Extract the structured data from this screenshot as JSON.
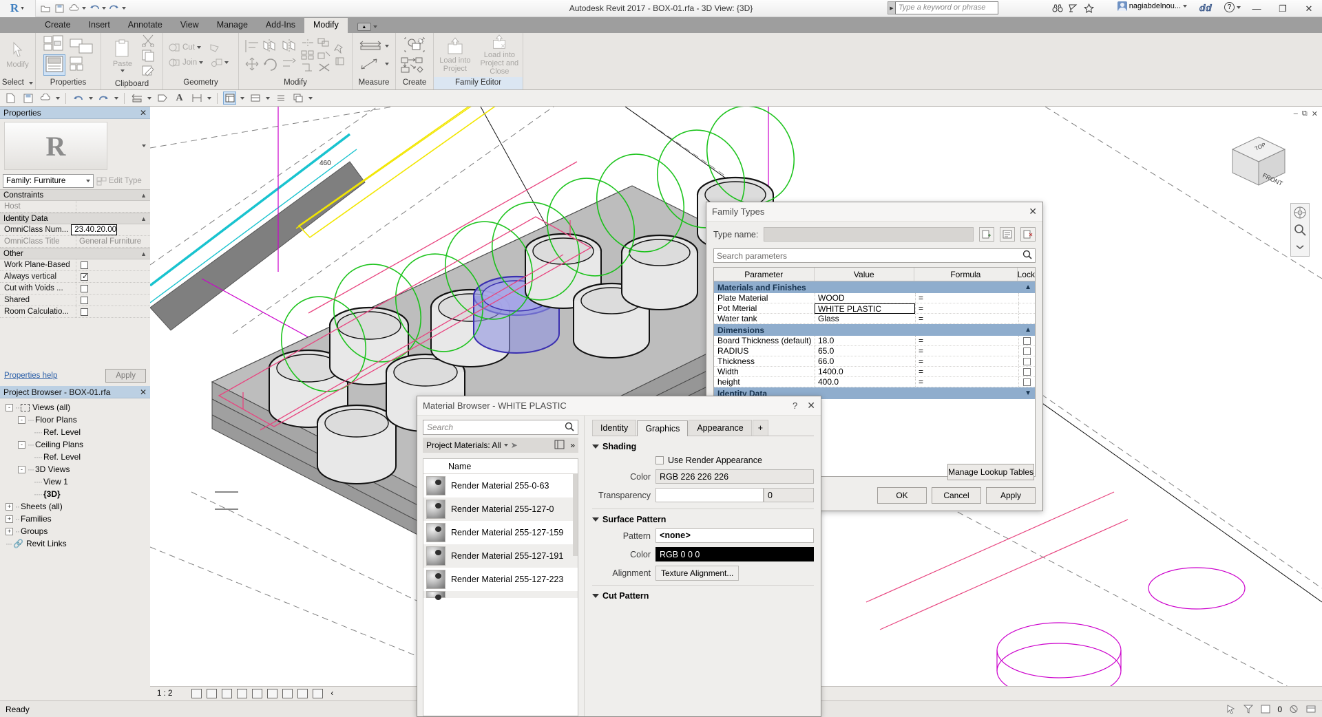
{
  "titlebar": {
    "app_title": "Autodesk Revit 2017 -   BOX-01.rfa - 3D View: {3D}",
    "search_placeholder": "Type a keyword or phrase",
    "account_name": "nagiabdelnou...",
    "help_label": "?",
    "minimize": "—",
    "maximize": "❐",
    "close": "✕",
    "logo": "R"
  },
  "ribbon": {
    "tabs": [
      {
        "label": "Create",
        "active": false
      },
      {
        "label": "Insert",
        "active": false
      },
      {
        "label": "Annotate",
        "active": false
      },
      {
        "label": "View",
        "active": false
      },
      {
        "label": "Manage",
        "active": false
      },
      {
        "label": "Add-Ins",
        "active": false
      },
      {
        "label": "Modify",
        "active": true
      }
    ],
    "panels": [
      {
        "title": "Select",
        "main_label": "Modify"
      },
      {
        "title": "Properties"
      },
      {
        "title": "Clipboard",
        "main_label": "Paste"
      },
      {
        "title": "Geometry",
        "items": [
          "Cut",
          "Join"
        ]
      },
      {
        "title": "Modify"
      },
      {
        "title": "Measure"
      },
      {
        "title": "Create"
      },
      {
        "title": "Family Editor",
        "items": [
          "Load into Project",
          "Load into Project and Close"
        ]
      }
    ],
    "geometry_cut": "Cut",
    "geometry_join": "Join",
    "load_into_project": "Load into\nProject",
    "load_into_project_close": "Load into\nProject and Close"
  },
  "properties": {
    "header": "Properties",
    "close": "✕",
    "family_type": "Family: Furniture",
    "edit_type": "Edit Type",
    "help_link": "Properties help",
    "apply_button": "Apply",
    "groups": [
      {
        "name": "Constraints",
        "rows": [
          {
            "key": "Host",
            "value": "",
            "dim": true,
            "type": "text"
          }
        ]
      },
      {
        "name": "Identity Data",
        "rows": [
          {
            "key": "OmniClass Num...",
            "value": "23.40.20.00",
            "type": "text-active"
          },
          {
            "key": "OmniClass Title",
            "value": "General Furniture",
            "dim": true,
            "type": "text"
          }
        ]
      },
      {
        "name": "Other",
        "rows": [
          {
            "key": "Work Plane-Based",
            "value": "",
            "type": "checkbox",
            "checked": false
          },
          {
            "key": "Always vertical",
            "value": "",
            "type": "checkbox",
            "checked": true
          },
          {
            "key": "Cut with Voids ...",
            "value": "",
            "type": "checkbox",
            "checked": false
          },
          {
            "key": "Shared",
            "value": "",
            "type": "checkbox",
            "checked": false
          },
          {
            "key": "Room Calculatio...",
            "value": "",
            "type": "checkbox",
            "checked": false
          }
        ]
      }
    ]
  },
  "project_browser": {
    "header": "Project Browser - BOX-01.rfa",
    "close": "✕",
    "nodes": [
      {
        "label": "Views (all)",
        "indent": 0,
        "expander": "-",
        "icon": true
      },
      {
        "label": "Floor Plans",
        "indent": 1,
        "expander": "-"
      },
      {
        "label": "Ref. Level",
        "indent": 2,
        "expander": ""
      },
      {
        "label": "Ceiling Plans",
        "indent": 1,
        "expander": "-"
      },
      {
        "label": "Ref. Level",
        "indent": 2,
        "expander": ""
      },
      {
        "label": "3D Views",
        "indent": 1,
        "expander": "-"
      },
      {
        "label": "View 1",
        "indent": 2,
        "expander": ""
      },
      {
        "label": "{3D}",
        "indent": 2,
        "expander": "",
        "bold": true
      },
      {
        "label": "Sheets (all)",
        "indent": 0,
        "expander": "+"
      },
      {
        "label": "Families",
        "indent": 0,
        "expander": "+"
      },
      {
        "label": "Groups",
        "indent": 0,
        "expander": "+"
      },
      {
        "label": "Revit Links",
        "indent": 0,
        "expander": ""
      }
    ]
  },
  "view": {
    "scale": "1 : 2",
    "cube_top": "TOP",
    "cube_front": "FRONT"
  },
  "statusbar": {
    "ready": "Ready",
    "selection_count": "0"
  },
  "family_types": {
    "title": "Family Types",
    "close": "✕",
    "type_name_label": "Type name:",
    "type_name_value": "",
    "search_placeholder": "Search parameters",
    "columns": [
      "Parameter",
      "Value",
      "Formula",
      "Lock"
    ],
    "groups": [
      {
        "name": "Materials and Finishes",
        "rows": [
          {
            "parameter": "Plate Material",
            "value": "WOOD",
            "formula": "=",
            "lock": false,
            "boxed": false
          },
          {
            "parameter": "Pot Mterial",
            "value": "WHITE PLASTIC",
            "formula": "=",
            "lock": false,
            "boxed": true
          },
          {
            "parameter": "Water tank",
            "value": "Glass",
            "formula": "=",
            "lock": false,
            "boxed": false
          }
        ]
      },
      {
        "name": "Dimensions",
        "rows": [
          {
            "parameter": "Board Thickness (default)",
            "value": "18.0",
            "formula": "=",
            "lock": true,
            "boxed": false
          },
          {
            "parameter": "RADIUS",
            "value": "65.0",
            "formula": "=",
            "lock": true,
            "boxed": false
          },
          {
            "parameter": "Thickness",
            "value": "66.0",
            "formula": "=",
            "lock": true,
            "boxed": false
          },
          {
            "parameter": "Width",
            "value": "1400.0",
            "formula": "=",
            "lock": true,
            "boxed": false
          },
          {
            "parameter": "height",
            "value": "400.0",
            "formula": "=",
            "lock": true,
            "boxed": false
          }
        ]
      },
      {
        "name": "Identity Data",
        "rows": []
      }
    ],
    "manage_lookup_tables": "Manage Lookup Tables",
    "ok": "OK",
    "cancel": "Cancel",
    "apply": "Apply"
  },
  "material_browser": {
    "title": "Material Browser - WHITE PLASTIC",
    "help": "?",
    "close": "✕",
    "search_placeholder": "Search",
    "filter_label": "Project Materials: All",
    "more": "»",
    "list_header": "Name",
    "materials": [
      {
        "name": "Render Material 255-0-63"
      },
      {
        "name": "Render Material 255-127-0"
      },
      {
        "name": "Render Material 255-127-159"
      },
      {
        "name": "Render Material 255-127-191"
      },
      {
        "name": "Render Material 255-127-223"
      }
    ],
    "tabs": [
      {
        "label": "Identity",
        "active": false
      },
      {
        "label": "Graphics",
        "active": true
      },
      {
        "label": "Appearance",
        "active": false
      }
    ],
    "plus_tab": "+",
    "shading": {
      "section": "Shading",
      "use_render_appearance": "Use Render Appearance",
      "use_render_appearance_checked": false,
      "color_label": "Color",
      "color_value": "RGB 226 226 226",
      "transparency_label": "Transparency",
      "transparency_value": "0"
    },
    "surface_pattern": {
      "section": "Surface Pattern",
      "pattern_label": "Pattern",
      "pattern_value": "<none>",
      "color_label": "Color",
      "color_value": "RGB 0 0 0",
      "alignment_label": "Alignment",
      "alignment_value": "Texture Alignment..."
    },
    "cut_pattern": {
      "section": "Cut Pattern"
    }
  }
}
